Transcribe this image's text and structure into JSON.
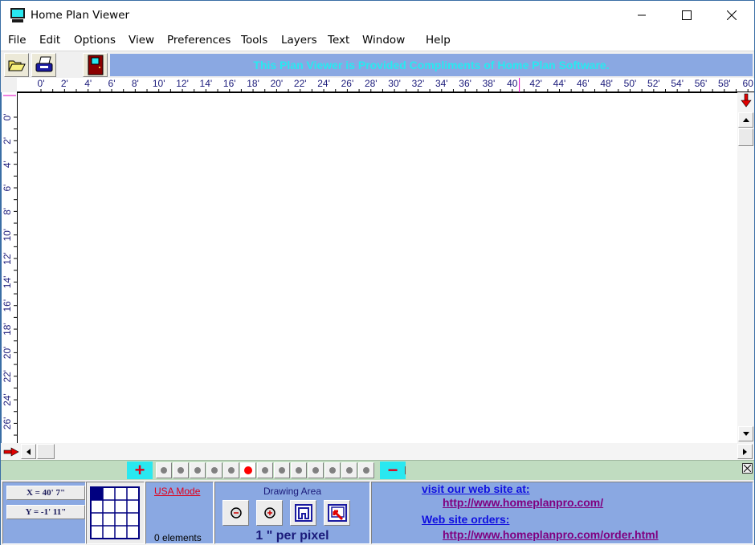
{
  "window": {
    "title": "Home Plan Viewer",
    "controls": {
      "minimize": "—",
      "maximize": "☐",
      "close": "✕"
    }
  },
  "menu": [
    "File",
    "Edit",
    "Options",
    "View",
    "Preferences",
    "Tools",
    "Layers",
    "Text",
    "Window",
    "Help"
  ],
  "toolbar": {
    "buttons": [
      {
        "name": "open-button",
        "icon": "folder-open-icon"
      },
      {
        "name": "print-button",
        "icon": "printer-icon"
      },
      {
        "name": "exit-button",
        "icon": "door-icon"
      }
    ],
    "banner": "This Plan Viewer is Provided Compliments of Home Plan Software."
  },
  "rulers": {
    "horizontal_labels": [
      "0'",
      "2'",
      "4'",
      "6'",
      "8'",
      "10'",
      "12'",
      "14'",
      "16'",
      "18'",
      "20'",
      "22'",
      "24'",
      "26'",
      "28'",
      "30'",
      "32'",
      "34'",
      "36'",
      "38'",
      "40",
      "42'",
      "44'",
      "46'",
      "48'",
      "50'",
      "52'",
      "54'",
      "56'",
      "58'",
      "60"
    ],
    "vertical_labels": [
      "0'",
      "2'",
      "4'",
      "6'",
      "8'",
      "10'",
      "12'",
      "14'",
      "16'",
      "18'",
      "20'",
      "22'",
      "24'",
      "26'"
    ],
    "cursor_x_feet": 40.6
  },
  "layers": {
    "add_label": "+",
    "remove_label": "−",
    "count": 13,
    "active_index": 5
  },
  "status": {
    "x_coord": "X = 40' 7\"",
    "y_coord": "Y = -1' 11\"",
    "mode_link": "USA Mode",
    "elements": "0 elements",
    "drawing_area_title": "Drawing Area",
    "scale": "1 \" per pixel",
    "zoom_buttons": [
      "zoom-out-button",
      "zoom-in-button",
      "fit-page-button",
      "zoom-window-button"
    ]
  },
  "links": {
    "visit_label": "visit our web site at:",
    "site_url": "http://www.homeplanpro.com/",
    "orders_label": "Web site orders:",
    "orders_url": "http://www.homeplanpro.com/order.html"
  },
  "colors": {
    "banner_bg": "#8aa8e2",
    "banner_text": "#29e8f0",
    "layer_bar": "#c0dcc0",
    "link_blue": "#1010e0",
    "link_visited": "#800080",
    "mode_red": "#e0001a"
  }
}
